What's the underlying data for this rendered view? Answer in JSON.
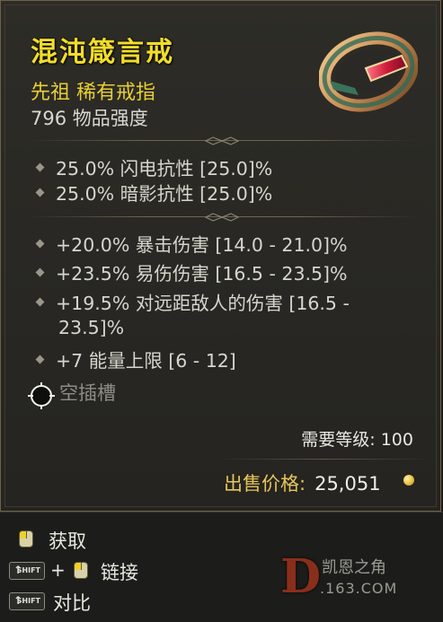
{
  "item": {
    "name": "混沌箴言戒",
    "rarity_line": "先祖 稀有戒指",
    "item_power": "796 物品强度",
    "implicit_stats": [
      "25.0% 闪电抗性 [25.0]%",
      "25.0% 暗影抗性 [25.0]%"
    ],
    "affixes": [
      "+20.0% 暴击伤害 [14.0 - 21.0]%",
      "+23.5% 易伤伤害 [16.5 - 23.5]%",
      "+19.5% 对远距敌人的伤害 [16.5 -",
      "+7 能量上限 [6 - 12]"
    ],
    "affix_wrap": "23.5]%",
    "socket_label": "空插槽",
    "required_level": "需要等级: 100",
    "sell_label": "出售价格:",
    "sell_value": "25,051",
    "icon": "ring-icon",
    "colors": {
      "title": "#f2dd2a",
      "rarity": "#e7cf33",
      "text": "#d6d6ce"
    }
  },
  "actions": {
    "acquire": "获取",
    "link_plus": "+",
    "link": "链接",
    "compare": "对比",
    "shift_key": "SHIFT"
  },
  "watermark": {
    "letter": "D",
    "name": "凯恩之角",
    "site": ".163.COM"
  }
}
